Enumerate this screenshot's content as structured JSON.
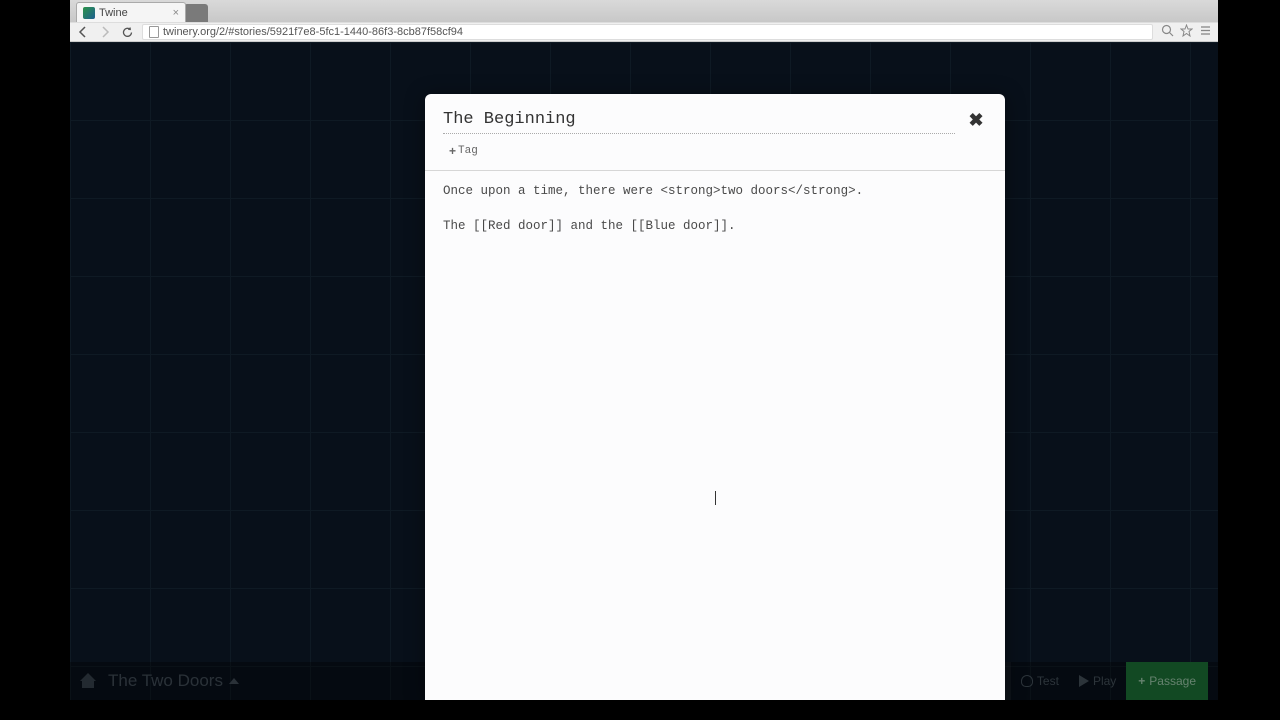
{
  "browser": {
    "tab_title": "Twine",
    "url": "twinery.org/2/#stories/5921f7e8-5fc1-1440-86f3-8cb87f58cf94"
  },
  "bottombar": {
    "story_title": "The Two Doors",
    "test_label": "Test",
    "play_label": "Play",
    "passage_label": "Passage"
  },
  "modal": {
    "title": "The Beginning",
    "tag_button": "Tag",
    "body": "Once upon a time, there were <strong>two doors</strong>.\n\nThe [[Red door]] and the [[Blue door]]."
  }
}
